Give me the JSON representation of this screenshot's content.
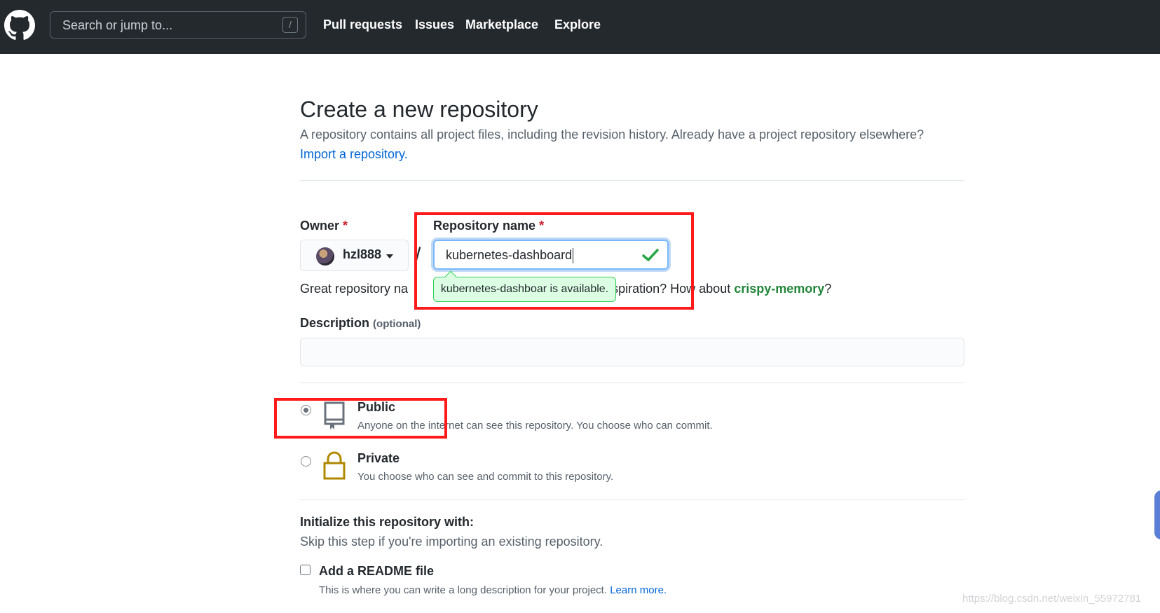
{
  "header": {
    "search_placeholder": "Search or jump to...",
    "search_shortcut": "/",
    "nav": [
      "Pull requests",
      "Issues",
      "Marketplace",
      "Explore"
    ]
  },
  "page": {
    "title": "Create a new repository",
    "subtitle": "A repository contains all project files, including the revision history. Already have a project repository elsewhere?",
    "import_link": "Import a repository."
  },
  "form": {
    "owner_label": "Owner",
    "owner_name": "hzl888",
    "repo_label": "Repository name",
    "required_mark": "*",
    "separator": "/",
    "repo_value": "kubernetes-dashboard",
    "availability_tip": "kubernetes-dashboar is available.",
    "great_prefix": "Great repository na",
    "great_middle": "d inspiration",
    "great_question": "? How about ",
    "great_suggestion": "crispy-memory",
    "great_end": "?",
    "description_label": "Description",
    "description_optional": "(optional)"
  },
  "visibility": {
    "public_title": "Public",
    "public_desc": "Anyone on the internet can see this repository. You choose who can commit.",
    "private_title": "Private",
    "private_desc": "You choose who can see and commit to this repository.",
    "selected": "public"
  },
  "init": {
    "title": "Initialize this repository with:",
    "subtitle": "Skip this step if you're importing an existing repository.",
    "readme_label": "Add a README file",
    "readme_desc": "This is where you can write a long description for your project.",
    "learn_more": "Learn more."
  },
  "watermark": "https://blog.csdn.net/weixin_55972781",
  "colors": {
    "header_bg": "#24292e",
    "link": "#0366d6",
    "success_green": "#22863a",
    "annotation_red": "#ff1a1a",
    "private_lock": "#b08800"
  }
}
